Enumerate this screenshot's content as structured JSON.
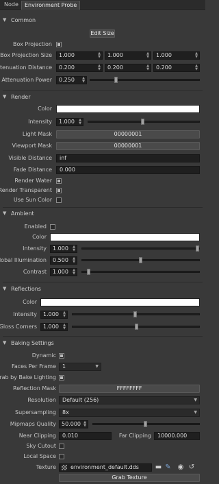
{
  "tabs": [
    {
      "label": "Node"
    },
    {
      "label": "Environment Probe"
    }
  ],
  "common": {
    "title": "Common",
    "edit_size": "Edit Size",
    "box_projection_label": "Box Projection",
    "box_projection_size_label": "Box Projection Size",
    "box_projection_size": [
      "1.000",
      "1.000",
      "1.000"
    ],
    "attenuation_distance_label": "Attenuation Distance",
    "attenuation_distance": [
      "0.200",
      "0.200",
      "0.200"
    ],
    "attenuation_power_label": "Attenuation Power",
    "attenuation_power": "0.250"
  },
  "render": {
    "title": "Render",
    "color_label": "Color",
    "intensity_label": "Intensity",
    "intensity": "1.000",
    "light_mask_label": "Light Mask",
    "light_mask": "00000001",
    "viewport_mask_label": "Viewport Mask",
    "viewport_mask": "00000001",
    "visible_distance_label": "Visible Distance",
    "visible_distance": "inf",
    "fade_distance_label": "Fade Distance",
    "fade_distance": "0.000",
    "render_water_label": "Render Water",
    "render_transparent_label": "Render Transparent",
    "use_sun_color_label": "Use Sun Color"
  },
  "ambient": {
    "title": "Ambient",
    "enabled_label": "Enabled",
    "color_label": "Color",
    "intensity_label": "Intensity",
    "intensity": "1.000",
    "gi_label": "Global Illumination",
    "gi": "0.500",
    "contrast_label": "Contrast",
    "contrast": "1.000"
  },
  "reflections": {
    "title": "Reflections",
    "color_label": "Color",
    "intensity_label": "Intensity",
    "intensity": "1.000",
    "gloss_label": "Gloss Corners",
    "gloss": "1.000"
  },
  "baking": {
    "title": "Baking Settings",
    "dynamic_label": "Dynamic",
    "faces_label": "Faces Per Frame",
    "faces": "1",
    "grab_label": "Grab by Bake Lighting",
    "reflection_mask_label": "Reflection Mask",
    "reflection_mask": "FFFFFFFF",
    "resolution_label": "Resolution",
    "resolution": "Default (256)",
    "supersampling_label": "Supersampling",
    "supersampling": "8x",
    "mipmaps_label": "Mipmaps Quality",
    "mipmaps": "50.000",
    "near_label": "Near Clipping",
    "near": "0.010",
    "far_label": "Far Clipping",
    "far": "10000.000",
    "sky_cutout_label": "Sky Cutout",
    "local_space_label": "Local Space",
    "texture_label": "Texture",
    "texture": "environment_default.dds",
    "grab_texture": "Grab Texture"
  }
}
